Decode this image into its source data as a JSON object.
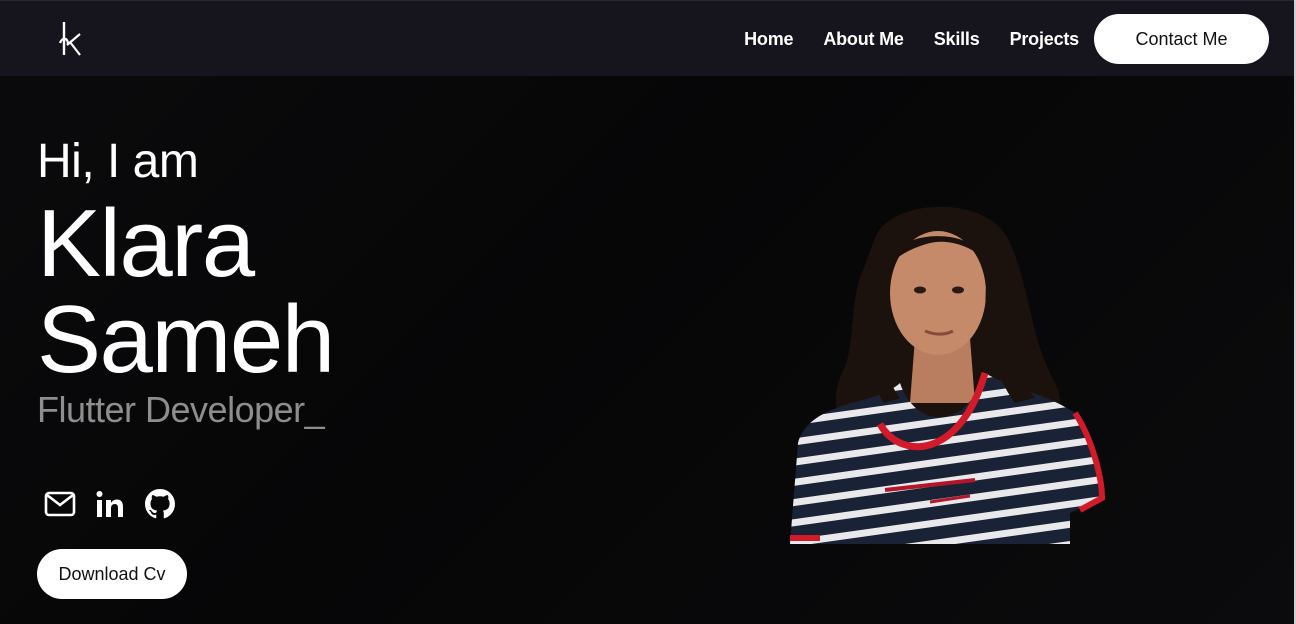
{
  "brand": {
    "logo_icon": "klara-logo-icon"
  },
  "nav": {
    "links": [
      {
        "label": "Home"
      },
      {
        "label": "About Me"
      },
      {
        "label": "Skills"
      },
      {
        "label": "Projects"
      }
    ],
    "contact_label": "Contact Me"
  },
  "hero": {
    "greeting": "Hi, I am",
    "first_name": "Klara",
    "last_name": "Sameh",
    "role": "Flutter Developer_"
  },
  "socials": [
    {
      "icon": "mail-icon"
    },
    {
      "icon": "linkedin-icon"
    },
    {
      "icon": "github-icon"
    }
  ],
  "cv_button_label": "Download Cv",
  "colors": {
    "nav_bg": "#16141c",
    "page_bg": "#070708",
    "accent_text": "#8e8e8e",
    "button_bg": "#ffffff"
  }
}
